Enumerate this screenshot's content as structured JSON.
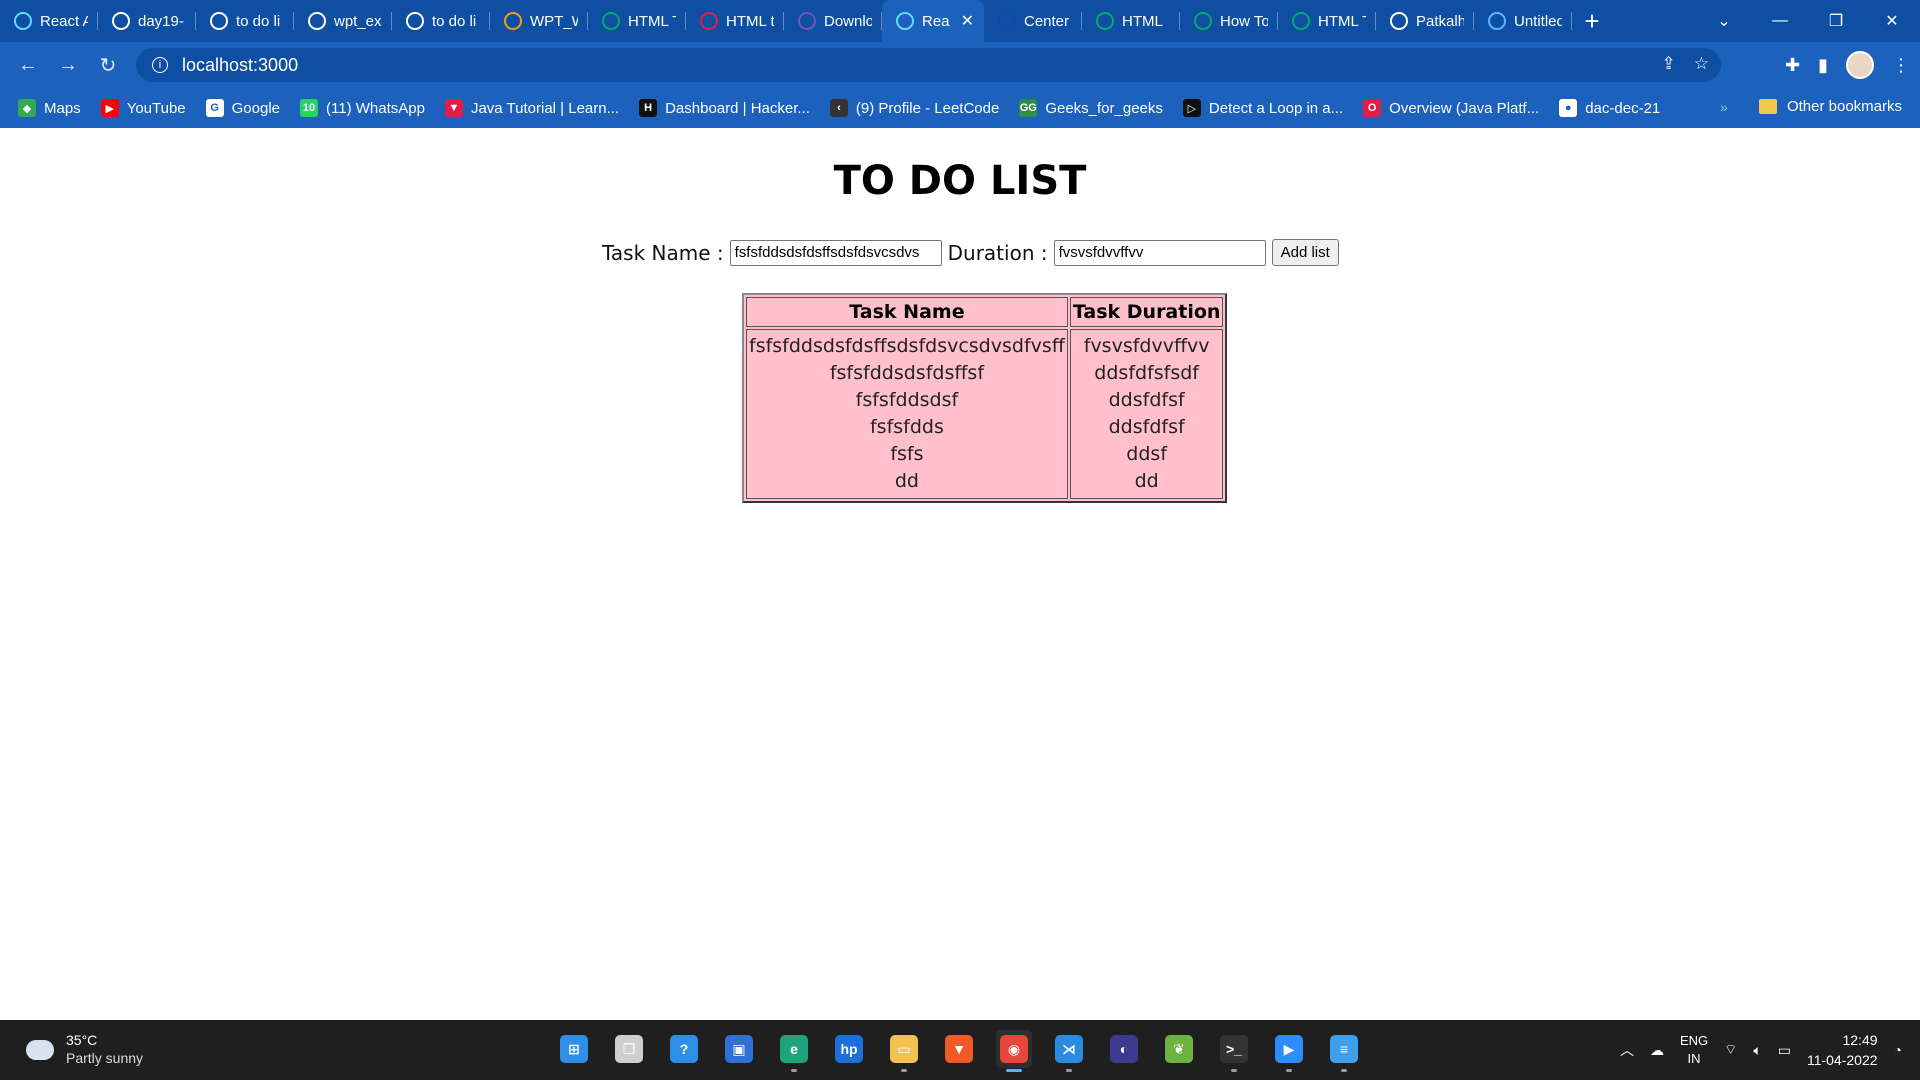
{
  "browser": {
    "tabs": [
      {
        "title": "React A",
        "icon": "react-icon",
        "color": "#61dafb"
      },
      {
        "title": "day19-",
        "icon": "github-icon",
        "color": "#ffffff"
      },
      {
        "title": "to do li",
        "icon": "google-icon",
        "color": "#ffffff"
      },
      {
        "title": "wpt_ex",
        "icon": "github-icon",
        "color": "#ffffff"
      },
      {
        "title": "to do li",
        "icon": "google-icon",
        "color": "#ffffff"
      },
      {
        "title": "WPT_W",
        "icon": "tutorial-icon",
        "color": "#f59e0b"
      },
      {
        "title": "HTML T",
        "icon": "w3schools-icon",
        "color": "#04aa6d"
      },
      {
        "title": "HTML t",
        "icon": "html-icon",
        "color": "#e11d48"
      },
      {
        "title": "Downlo",
        "icon": "bootstrap-icon",
        "color": "#7952b3"
      },
      {
        "title": "Rea",
        "icon": "react-icon",
        "color": "#61dafb",
        "active": true
      },
      {
        "title": "Center",
        "icon": "center-icon",
        "color": "#1e40af"
      },
      {
        "title": "HTML",
        "icon": "w3schools-icon",
        "color": "#04aa6d"
      },
      {
        "title": "How To",
        "icon": "w3schools-icon",
        "color": "#04aa6d"
      },
      {
        "title": "HTML T",
        "icon": "w3schools-icon",
        "color": "#04aa6d"
      },
      {
        "title": "Patkalh",
        "icon": "github-icon",
        "color": "#ffffff"
      },
      {
        "title": "Untitled",
        "icon": "dot-icon",
        "color": "#5fb2ff"
      }
    ],
    "url": "localhost:3000",
    "bookmarks": [
      {
        "label": "Maps",
        "icon": "maps-icon",
        "color": "#34a853",
        "glyph": "◆"
      },
      {
        "label": "YouTube",
        "icon": "youtube-icon",
        "color": "#ff0000",
        "glyph": "▶"
      },
      {
        "label": "Google",
        "icon": "google-icon",
        "color": "#ffffff",
        "glyph": "G"
      },
      {
        "label": "(11) WhatsApp",
        "icon": "whatsapp-icon",
        "color": "#25d366",
        "glyph": "10"
      },
      {
        "label": "Java Tutorial | Learn...",
        "icon": "java-tutorial-icon",
        "color": "#e11d48",
        "glyph": "▼"
      },
      {
        "label": "Dashboard | Hacker...",
        "icon": "hackerrank-icon",
        "color": "#111111",
        "glyph": "H"
      },
      {
        "label": "(9) Profile - LeetCode",
        "icon": "leetcode-icon",
        "color": "#333333",
        "glyph": "‹"
      },
      {
        "label": "Geeks_for_geeks",
        "icon": "geeksforgeeks-icon",
        "color": "#2f8d46",
        "glyph": "GG"
      },
      {
        "label": "Detect a Loop in a...",
        "icon": "play-icon",
        "color": "#111111",
        "glyph": "▷"
      },
      {
        "label": "Overview (Java Platf...",
        "icon": "oracle-icon",
        "color": "#e11d48",
        "glyph": "O"
      },
      {
        "label": "dac-dec-21",
        "icon": "github-icon",
        "color": "#ffffff",
        "glyph": "●"
      }
    ],
    "other_bookmarks": "Other bookmarks"
  },
  "app": {
    "title": "TO DO LIST",
    "task_label": "Task Name :",
    "task_value": "fsfsfddsdsfdsffsdsfdsvcsdvs",
    "duration_label": "Duration :",
    "duration_value": "fvsvsfdvvffvv",
    "add_button": "Add list",
    "columns": [
      "Task Name",
      "Task Duration"
    ],
    "tasks": [
      "fsfsfddsdsfdsffsdsfdsvcsdvsdfvsff",
      "fsfsfddsdsfdsffsf",
      "fsfsfddsdsf",
      "fsfsfdds",
      "fsfs",
      "dd"
    ],
    "durations": [
      "fvsvsfdvvffvv",
      "ddsfdfsfsdf",
      "ddsfdfsf",
      "ddsfdfsf",
      "ddsf",
      "dd"
    ]
  },
  "taskbar": {
    "temperature": "35°C",
    "weather": "Partly sunny",
    "apps": [
      {
        "name": "windows-start-icon",
        "color": "#2f8fe6",
        "glyph": "⊞"
      },
      {
        "name": "task-view-icon",
        "color": "#cfcfcf",
        "glyph": "❐"
      },
      {
        "name": "help-icon",
        "color": "#2f8fe6",
        "glyph": "?"
      },
      {
        "name": "store-icon",
        "color": "#2f6fd6",
        "glyph": "▣"
      },
      {
        "name": "edge-icon",
        "color": "#1fa37a",
        "glyph": "e"
      },
      {
        "name": "hp-icon",
        "color": "#1e6fd9",
        "glyph": "hp"
      },
      {
        "name": "file-explorer-icon",
        "color": "#f2c14e",
        "glyph": "▭"
      },
      {
        "name": "brave-icon",
        "color": "#f05a28",
        "glyph": "▼"
      },
      {
        "name": "chrome-icon",
        "color": "#e8453c",
        "glyph": "◉",
        "active": true
      },
      {
        "name": "vscode-icon",
        "color": "#2a8be0",
        "glyph": "⋊"
      },
      {
        "name": "eclipse-icon",
        "color": "#3b3a8f",
        "glyph": "◐"
      },
      {
        "name": "spring-icon",
        "color": "#6db33f",
        "glyph": "❦"
      },
      {
        "name": "terminal-icon",
        "color": "#333333",
        "glyph": ">_"
      },
      {
        "name": "zoom-icon",
        "color": "#2d8cff",
        "glyph": "▶"
      },
      {
        "name": "notepad-icon",
        "color": "#3ea0e8",
        "glyph": "≡"
      }
    ],
    "lang_1": "ENG",
    "lang_2": "IN",
    "time": "12:49",
    "date": "11-04-2022"
  }
}
